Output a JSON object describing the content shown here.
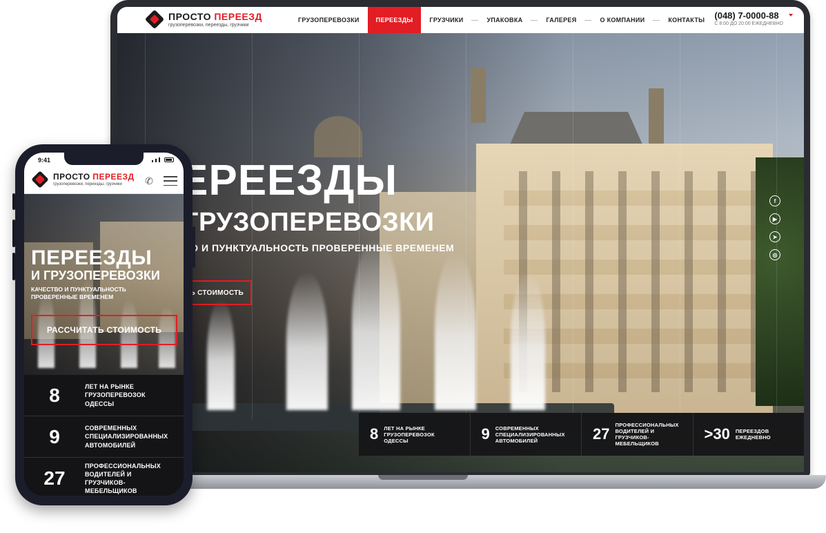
{
  "brand": {
    "name_part1": "ПРОСТО",
    "name_part2": "ПЕРЕЕЗД",
    "tagline": "грузоперевозки, переезды, грузчики"
  },
  "nav": {
    "items": [
      "ГРУЗОПЕРЕВОЗКИ",
      "ПЕРЕЕЗДЫ",
      "ГРУЗЧИКИ",
      "УПАКОВКА",
      "ГАЛЕРЕЯ",
      "О КОМПАНИИ",
      "КОНТАКТЫ"
    ],
    "active_index": 1
  },
  "contact": {
    "phone": "(048) 7-0000-88",
    "hours": "С 8:00 ДО 20:00 ЕЖЕДНЕВНО"
  },
  "desktop_hero": {
    "title": "ЕРЕЕЗДЫ",
    "subtitle": "ГРУЗОПЕРЕВОЗКИ",
    "tagline": "ВО И ПУНКТУАЛЬНОСТЬ ПРОВЕРЕННЫЕ ВРЕМЕНЕМ",
    "cta": "ТЬ СТОИМОСТЬ"
  },
  "social": [
    "facebook-icon",
    "youtube-icon",
    "telegram-icon",
    "instagram-icon"
  ],
  "desktop_stats": [
    {
      "number": "8",
      "text": "ЛЕТ НА РЫНКЕ ГРУЗОПЕРЕВОЗОК ОДЕССЫ"
    },
    {
      "number": "9",
      "text": "СОВРЕМЕННЫХ СПЕЦИАЛИЗИРОВАННЫХ АВТОМОБИЛЕЙ"
    },
    {
      "number": "27",
      "text": "ПРОФЕССИОНАЛЬНЫХ ВОДИТЕЛЕЙ И ГРУЗЧИКОВ-МЕБЕЛЬЩИКОВ"
    },
    {
      "number": ">30",
      "text": "ПЕРЕЕЗДОВ ЕЖЕДНЕВНО"
    }
  ],
  "mobile": {
    "time": "9:41",
    "title": "ПЕРЕЕЗДЫ",
    "subtitle": "И ГРУЗОПЕРЕВОЗКИ",
    "tagline": "КАЧЕСТВО И ПУНКТУАЛЬНОСТЬ ПРОВЕРЕННЫЕ ВРЕМЕНЕМ",
    "cta": "РАССЧИТАТЬ СТОИМОСТЬ",
    "stats": [
      {
        "number": "8",
        "text": "ЛЕТ НА РЫНКЕ ГРУЗОПЕРЕВОЗОК ОДЕССЫ"
      },
      {
        "number": "9",
        "text": "СОВРЕМЕННЫХ СПЕЦИАЛИЗИРОВАННЫХ АВТОМОБИЛЕЙ"
      },
      {
        "number": "27",
        "text": "ПРОФЕССИОНАЛЬНЫХ ВОДИТЕЛЕЙ И ГРУЗЧИКОВ-МЕБЕЛЬЩИКОВ"
      }
    ]
  },
  "colors": {
    "accent": "#e21d24",
    "dark": "#161618",
    "header_bg": "#ffffff"
  }
}
